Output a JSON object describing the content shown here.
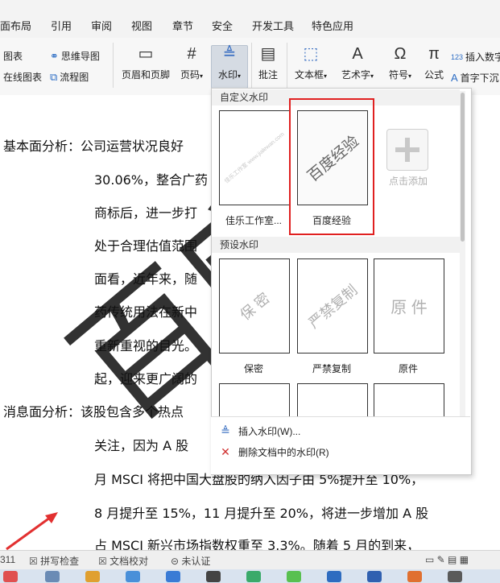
{
  "menu": [
    "面布局",
    "引用",
    "审阅",
    "视图",
    "章节",
    "安全",
    "开发工具",
    "特色应用"
  ],
  "ribbon": {
    "left_small": [
      "图表",
      "在线图表"
    ],
    "mind": [
      "思维导图",
      "流程图"
    ],
    "header_footer": "页眉和页脚",
    "page_number": "页码",
    "watermark": "水印",
    "comment": "批注",
    "textbox": "文本框",
    "art_text": "艺术字",
    "symbol": "符号",
    "formula": "公式",
    "insert_number": "插入数字",
    "drop_cap": "首字下沉"
  },
  "document": {
    "lines": [
      "基本面分析：公司运营状况良好",
      "30.06%，整合广药",
      "商标后，进一步打",
      "处于合理估值范围",
      "面看，近年来，随",
      "药传统用法在新中",
      "重新重视的目光。",
      "起，迎来更广阔的",
      "消息面分析：该股包含多个热点",
      "关注，因为 A 股",
      "月 MSCI 将把中国大盘股的纳入因子由 5%提升至 10%，",
      "8 月提升至 15%，11 月提升至 20%，将进一步增加 A 股",
      "占 MSCI 新兴市场指数权重至 3.3%。随着 5 月的到来，"
    ],
    "watermark_text": "百度"
  },
  "panel": {
    "custom_header": "自定义水印",
    "custom": [
      {
        "label": "佳乐工作室...",
        "text": "佳乐工作室 www.jialewan.com"
      },
      {
        "label": "百度经验",
        "text": "百度经验"
      }
    ],
    "add_label": "点击添加",
    "preset_header": "预设水印",
    "preset": [
      {
        "label": "保密",
        "text": "保 密"
      },
      {
        "label": "严禁复制",
        "text": "严禁复制"
      },
      {
        "label": "原件",
        "text": "原 件"
      }
    ],
    "insert_watermark": "插入水印(W)...",
    "delete_watermark": "删除文档中的水印(R)"
  },
  "status": {
    "page_num": "311",
    "spell_check": "拼写检查",
    "doc_proof": "文档校对",
    "not_certified": "未认证"
  },
  "colors": {
    "highlight": "#e02020",
    "accent": "#2b6cc4"
  }
}
